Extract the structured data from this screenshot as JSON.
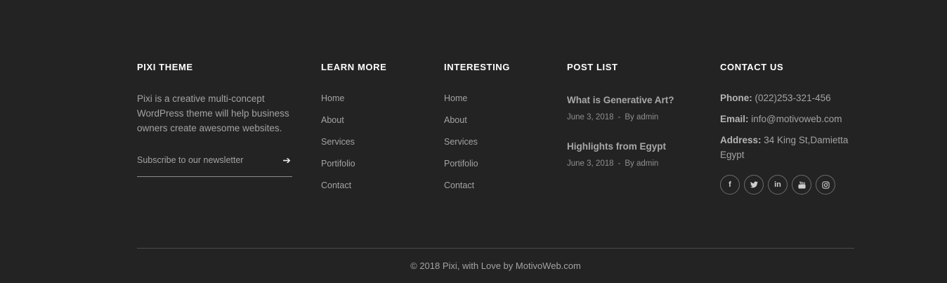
{
  "col1": {
    "title": "PIXI THEME",
    "text": "Pixi is a creative multi-concept WordPress theme will help business owners create awesome websites.",
    "newsletter_placeholder": "Subscribe to our newsletter",
    "arrow_icon": "arrow-right-icon"
  },
  "col2": {
    "title": "LEARN MORE",
    "links": [
      "Home",
      "About",
      "Services",
      "Portifolio",
      "Contact"
    ]
  },
  "col3": {
    "title": "INTERESTING",
    "links": [
      "Home",
      "About",
      "Services",
      "Portifolio",
      "Contact"
    ]
  },
  "col4": {
    "title": "POST LIST",
    "posts": [
      {
        "title": "What is Generative Art?",
        "date": "June 3, 2018",
        "sep": "-",
        "author": "By admin"
      },
      {
        "title": "Highlights from Egypt",
        "date": "June 3, 2018",
        "sep": "-",
        "author": "By admin"
      }
    ]
  },
  "col5": {
    "title": "CONTACT US",
    "phone_label": "Phone:",
    "phone": "(022)253-321-456",
    "email_label": "Email:",
    "email": "info@motivoweb.com",
    "address_label": "Address:",
    "address": "34 King St,Damietta Egypt",
    "socials": [
      {
        "icon": "facebook-icon",
        "glyph": "f"
      },
      {
        "icon": "twitter-icon",
        "glyph": "🐦"
      },
      {
        "icon": "linkedin-icon",
        "glyph": "in"
      },
      {
        "icon": "youtube-icon",
        "glyph": "▶"
      },
      {
        "icon": "instagram-icon",
        "glyph": "◎"
      }
    ]
  },
  "footer": {
    "copyright": "© 2018 Pixi, with Love by MotivoWeb.com"
  }
}
